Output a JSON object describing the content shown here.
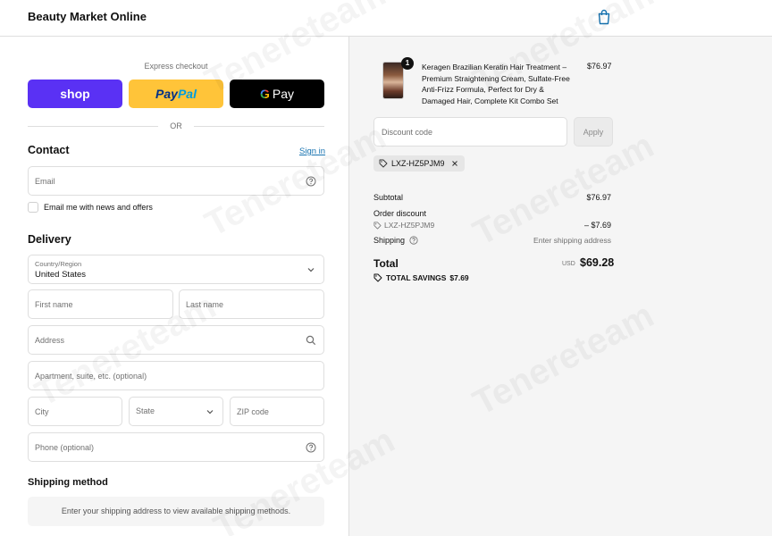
{
  "header": {
    "brand": "Beauty Market Online"
  },
  "express": {
    "label": "Express checkout",
    "shop_label": "shop",
    "paypal_part1": "Pay",
    "paypal_part2": "Pal",
    "gpay_g": "G",
    "gpay_label": "Pay",
    "or_label": "OR"
  },
  "contact": {
    "title": "Contact",
    "signin": "Sign in",
    "email_placeholder": "Email",
    "newsletter_label": "Email me with news and offers"
  },
  "delivery": {
    "title": "Delivery",
    "country_label": "Country/Region",
    "country_value": "United States",
    "first_name": "First name",
    "last_name": "Last name",
    "address": "Address",
    "apartment": "Apartment, suite, etc. (optional)",
    "city": "City",
    "state": "State",
    "zip": "ZIP code",
    "phone": "Phone (optional)"
  },
  "shipping_method": {
    "title": "Shipping method",
    "note": "Enter your shipping address to view available shipping methods."
  },
  "order": {
    "quantity": "1",
    "product_name": "Keragen Brazilian Keratin Hair Treatment – Premium Straightening Cream, Sulfate-Free Anti-Frizz Formula, Perfect for Dry & Damaged Hair, Complete Kit Combo Set",
    "product_price": "$76.97",
    "discount_placeholder": "Discount code",
    "apply_label": "Apply",
    "applied_code": "LXZ-HZ5PJM9",
    "subtotal_label": "Subtotal",
    "subtotal_value": "$76.97",
    "order_discount_label": "Order discount",
    "order_discount_code": "LXZ-HZ5PJM9",
    "order_discount_value": "– $7.69",
    "shipping_label": "Shipping",
    "shipping_value": "Enter shipping address",
    "total_label": "Total",
    "total_currency": "USD",
    "total_value": "$69.28",
    "savings_label": "TOTAL SAVINGS",
    "savings_value": "$7.69"
  },
  "watermark": "Tenereteam"
}
